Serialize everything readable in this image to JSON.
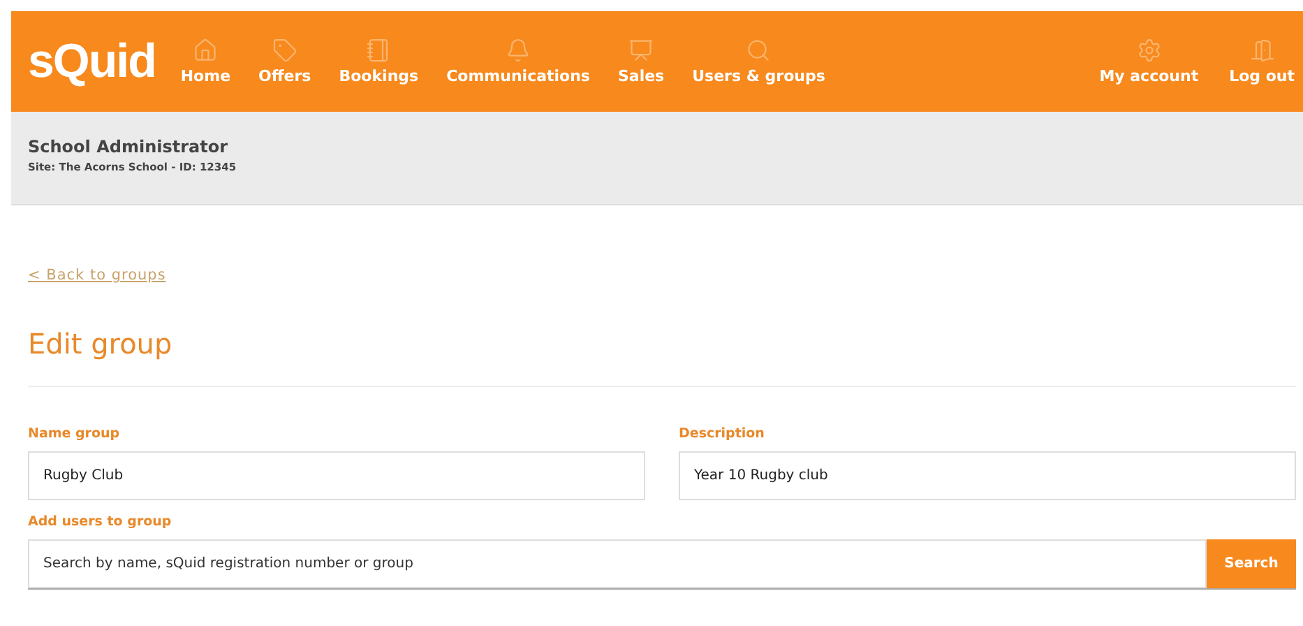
{
  "header": {
    "logo": "sQuid",
    "nav": [
      {
        "label": "Home"
      },
      {
        "label": "Offers"
      },
      {
        "label": "Bookings"
      },
      {
        "label": "Communications"
      },
      {
        "label": "Sales"
      },
      {
        "label": "Users & groups"
      }
    ],
    "account": [
      {
        "label": "My account"
      },
      {
        "label": "Log out"
      }
    ]
  },
  "user_bar": {
    "role": "School Administrator",
    "site": "Site: The Acorns School - ID: 12345"
  },
  "back_link": "< Back to groups",
  "title": "Edit group",
  "fields": [
    {
      "label": "Name group",
      "value": "Rugby Club"
    },
    {
      "label": "Description",
      "value": "Year 10 Rugby club"
    }
  ],
  "add_users": {
    "label": "Add users to group",
    "placeholder": "Search by name, sQuid registration number or group",
    "button": "Search"
  }
}
